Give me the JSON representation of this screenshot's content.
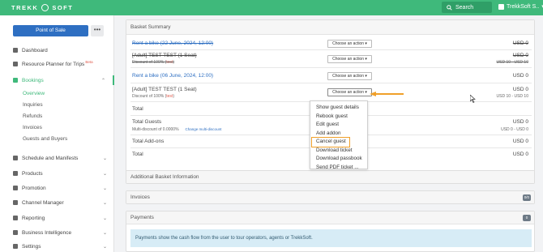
{
  "topbar": {
    "logo_left": "TREKK",
    "logo_right": "SOFT",
    "search_label": "Search",
    "user_label": "TrekkSoft S..",
    "color": "#3fb97b"
  },
  "sidebar": {
    "pos_button": "Point of Sale",
    "more_button": "•••",
    "items": [
      {
        "label": "Dashboard",
        "icon": "dashboard-icon"
      },
      {
        "label": "Resource Planner for Trips",
        "beta": "Beta",
        "icon": "resource-icon"
      },
      {
        "label": "Bookings",
        "icon": "bookings-icon",
        "chevron": "^"
      },
      {
        "label": "Schedule and Manifests",
        "icon": "calendar-icon",
        "chevron": "v"
      },
      {
        "label": "Products",
        "icon": "products-icon",
        "chevron": "v"
      },
      {
        "label": "Promotion",
        "icon": "promotion-icon",
        "chevron": "v"
      },
      {
        "label": "Channel Manager",
        "icon": "channel-icon",
        "chevron": "v"
      },
      {
        "label": "Reporting",
        "icon": "reporting-icon",
        "chevron": "v"
      },
      {
        "label": "Business Intelligence",
        "icon": "bi-icon",
        "chevron": "v"
      },
      {
        "label": "Settings",
        "icon": "settings-icon",
        "chevron": "v"
      }
    ],
    "bookings_sub": [
      "Overview",
      "Inquiries",
      "Refunds",
      "Invoices",
      "Guests and Buyers"
    ]
  },
  "basket": {
    "title": "Basket Summary",
    "rows": [
      {
        "title": "Rent a bike (22 June, 2024, 12:00)",
        "action": "Choose an action",
        "price": "USD 0"
      },
      {
        "title": "[Adult] TEST TEST (1 Seat)",
        "sub": "Discount of 100% (",
        "sub_tag": "test",
        "sub_end": ")",
        "action": "Choose an action",
        "price": "USD 0",
        "price_sub": "USD 10 - USD 10"
      },
      {
        "title": "Rent a bike (06 June, 2024, 12:00)",
        "action": "Choose an action",
        "price": "USD 0"
      },
      {
        "title": "[Adult] TEST TEST (1 Seat)",
        "sub": "Discount of 100% (",
        "sub_tag": "test",
        "sub_end": ")",
        "action": "Choose an action",
        "price": "USD 0",
        "price_sub": "USD 10 - USD 10"
      }
    ],
    "total_label": "Total",
    "total_guests_label": "Total Guests",
    "multi_discount": "Multi-discount of 0.0000%",
    "change_discount": "Change multi-discount",
    "total_guests_price": "USD 0",
    "total_guests_sub": "USD 0 - USD 0",
    "total_addons_label": "Total Add-ons",
    "total_addons_price": "USD 0",
    "total2_label": "Total",
    "total2_price": "USD 0"
  },
  "dropdown": {
    "items": [
      "Show guest details",
      "Rebook guest",
      "Edit guest",
      "Add addon",
      "Cancel guest",
      "Download ticket",
      "Download passbook",
      "Send PDF ticket ..."
    ],
    "highlight_color": "#f0a02a"
  },
  "panels": {
    "additional": "Additional Basket Information",
    "invoices": "Invoices",
    "invoices_badge": "0/0",
    "payments": "Payments",
    "payments_badge": "0",
    "payments_info": "Payments show the cash flow from the user to tour operators, agents or TrekkSoft."
  }
}
